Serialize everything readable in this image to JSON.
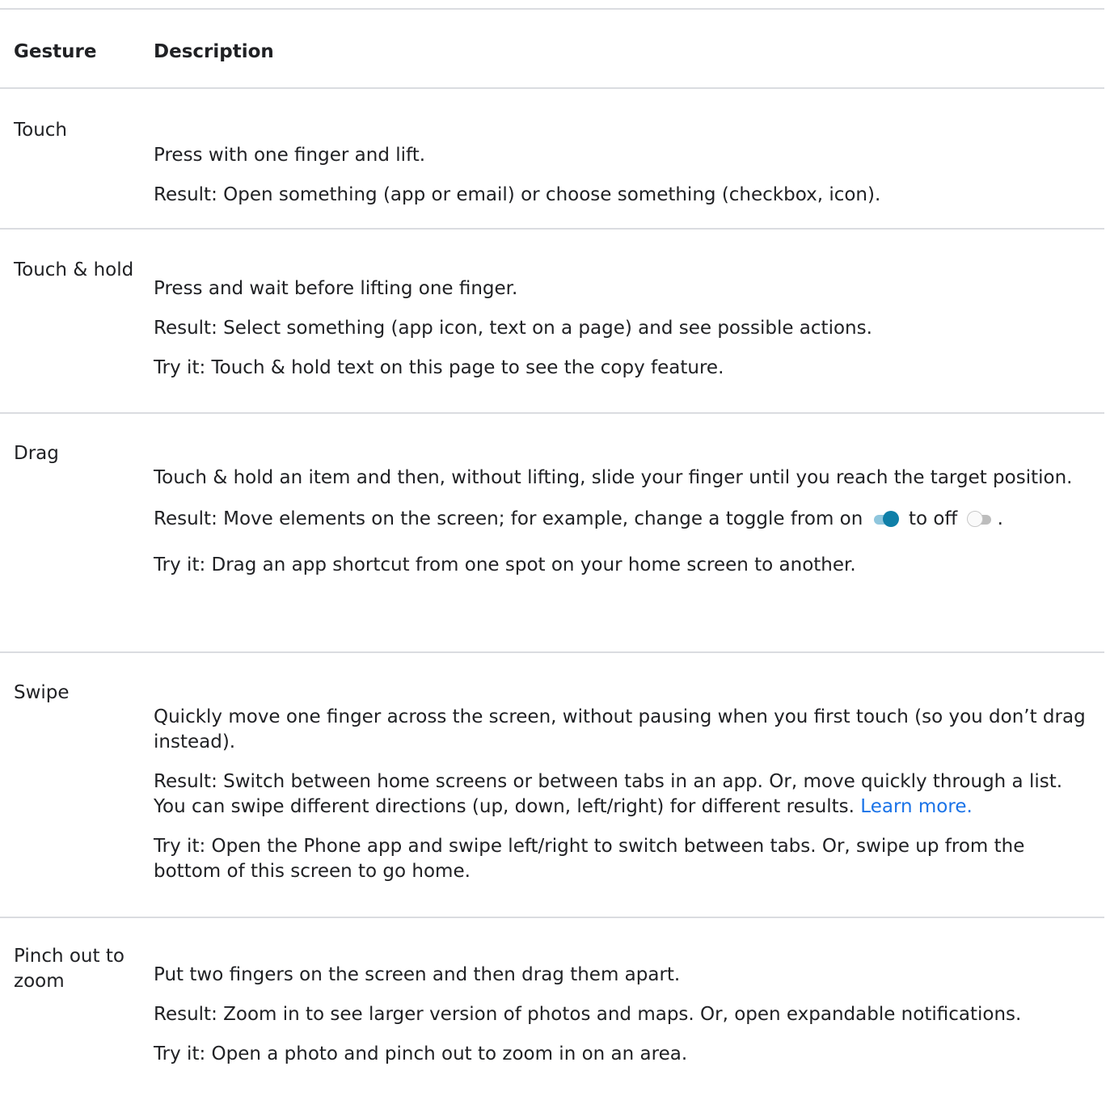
{
  "header": {
    "gesture": "Gesture",
    "description": "Description"
  },
  "rows": [
    {
      "gesture": "Touch",
      "lines": [
        "Press with one finger and lift.",
        "Result: Open something (app or email) or choose something (checkbox, icon)."
      ]
    },
    {
      "gesture": "Touch & hold",
      "lines": [
        "Press and wait before lifting one finger.",
        "Result: Select something (app icon, text on a page) and see possible actions.",
        "Try it: Touch & hold text on this page to see the copy feature."
      ]
    },
    {
      "gesture": "Drag",
      "lines": [
        "Touch & hold an item and then, without lifting, slide your finger until you reach the target position.",
        "Result: Move elements on the screen; for example, change a toggle from on",
        "to off",
        ".",
        "Try it: Drag an app shortcut from one spot on your home screen to another."
      ]
    },
    {
      "gesture": "Swipe",
      "lines": [
        "Quickly move one finger across the screen, without pausing when you first touch (so you don’t drag instead).",
        "Result: Switch between home screens or between tabs in an app. Or, move quickly through a list. You can swipe different directions (up, down, left/right) for different results.",
        "Learn more.",
        "Try it: Open the Phone app and swipe left/right to switch between tabs. Or, swipe up from the bottom of this screen to go home."
      ]
    },
    {
      "gesture": "Pinch out to zoom",
      "lines": [
        "Put two fingers on the screen and then drag them apart.",
        "Result: Zoom in to see larger version of photos and maps. Or, open expandable notifications.",
        "Try it: Open a photo and pinch out to zoom in on an area."
      ]
    }
  ],
  "toggles": {
    "on": {
      "state": "on",
      "track_color": "#8fc6dd",
      "thumb_color": "#0f7fa8"
    },
    "off": {
      "state": "off",
      "track_color": "#bdbdbd",
      "thumb_color": "#fafafa"
    }
  },
  "colors": {
    "link": "#1a73e8",
    "divider": "#dadce0",
    "text": "#202124"
  }
}
